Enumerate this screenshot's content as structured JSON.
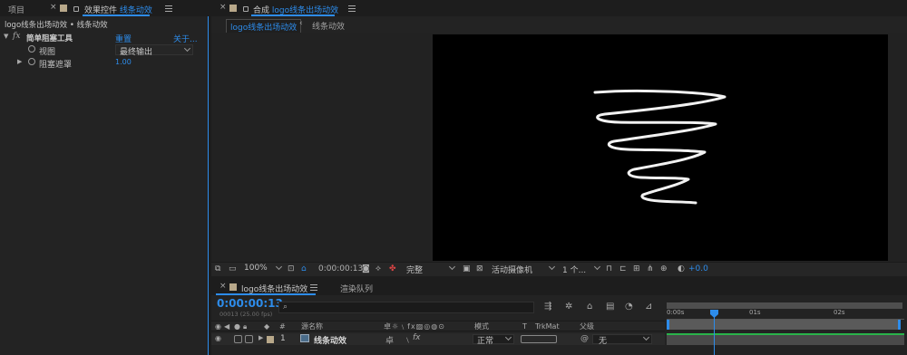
{
  "left_panel": {
    "tab_project": "项目",
    "tab_effect_controls": "效果控件",
    "tab_effect_layer": "线条动效",
    "breadcrumb": "logo线条出场动效 • 线条动效",
    "effect": {
      "fx_label": "fx",
      "name": "简单阻塞工具",
      "reset": "重置",
      "about": "关于...",
      "props": [
        {
          "label": "视图",
          "value": "最终输出"
        },
        {
          "label": "阻塞遮罩",
          "value": "1.00"
        }
      ]
    }
  },
  "comp_panel": {
    "tab_prefix": "合成",
    "tab_name": "logo线条出场动效",
    "sub_tab_active": "logo线条出场动效",
    "sub_tab_other": "线条动效",
    "footer": {
      "zoom": "100%",
      "timecode": "0:00:00:13",
      "quality": "完整",
      "camera": "活动摄像机",
      "views": "1 个...",
      "exposure": "+0.0"
    }
  },
  "timeline": {
    "tab_comp": "logo线条出场动效",
    "tab_render": "渲染队列",
    "timecode": "0:00:00:13",
    "frame_info": "00013 (25.00 fps)",
    "search_placeholder": "",
    "ruler_labels": [
      "0:00s",
      "01s",
      "02s"
    ],
    "columns": {
      "num": "#",
      "source": "源名称",
      "mode": "模式",
      "t": "T",
      "trkmat": "TrkMat",
      "parent": "父级"
    },
    "layer": {
      "num": "1",
      "name": "线条动效",
      "mode": "正常",
      "parent": "无"
    }
  },
  "colors": {
    "accent": "#2d8ceb",
    "layer_swatch": "#b8a88a",
    "track_bar": "#5a5a5a",
    "track_bar_green": "#29b34a"
  }
}
